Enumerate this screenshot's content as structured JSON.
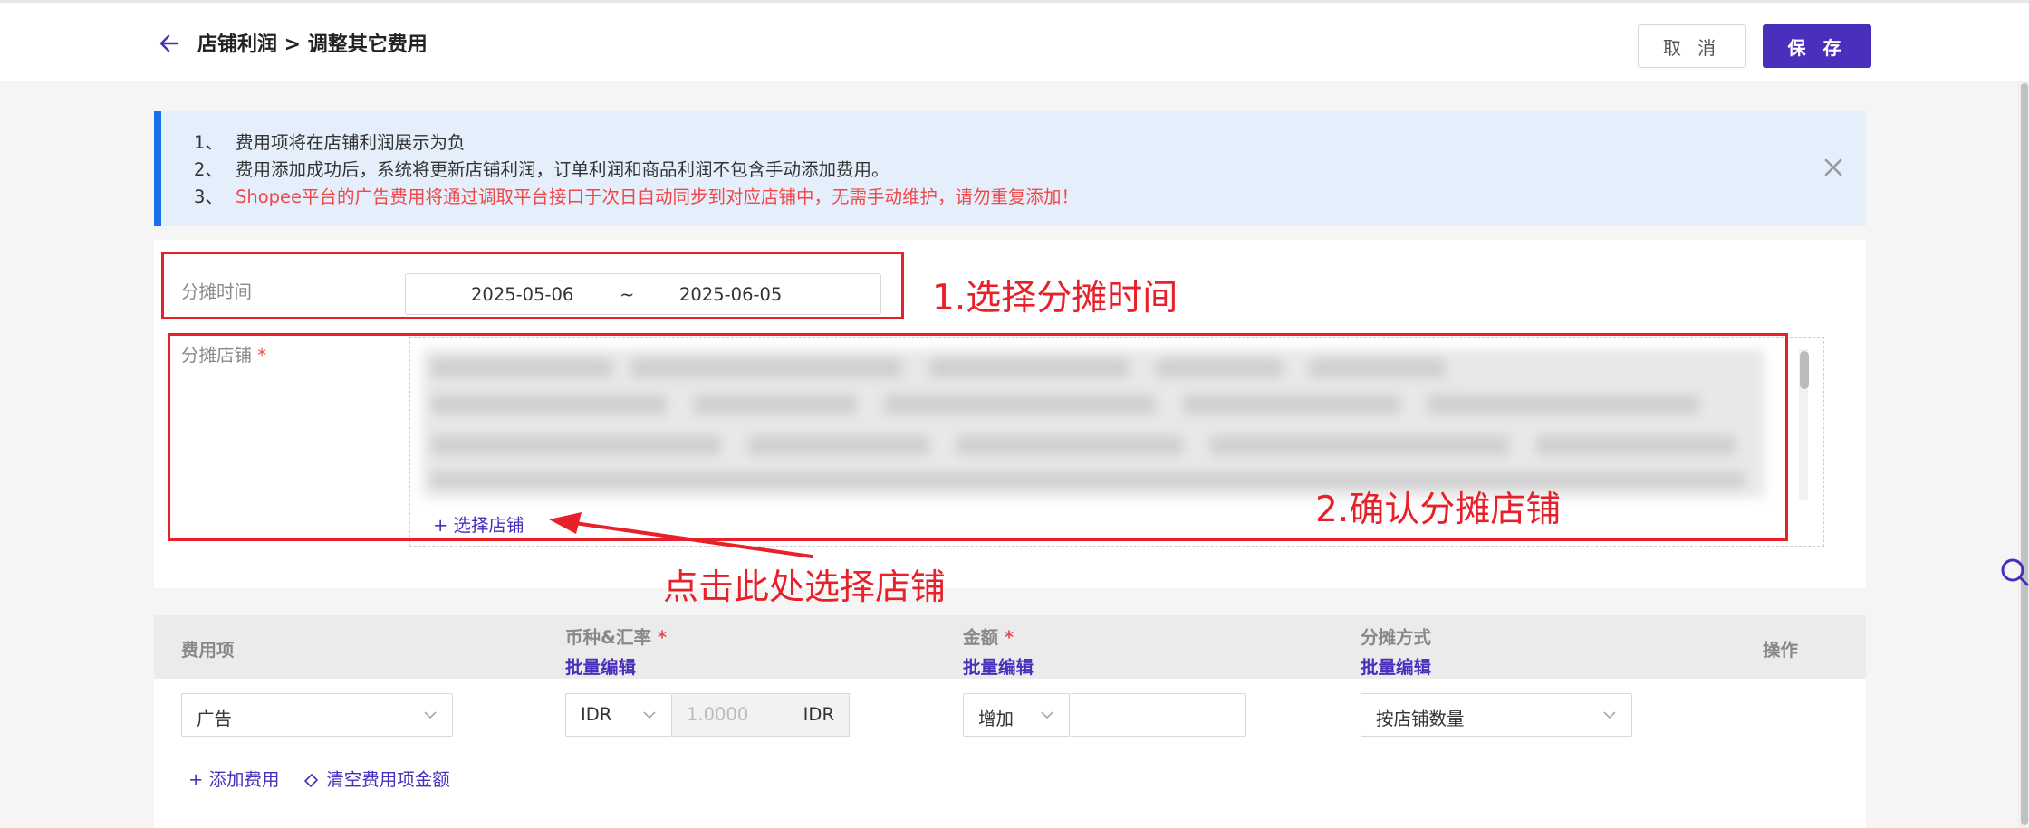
{
  "header": {
    "breadcrumb": "店铺利润 > 调整其它费用",
    "cancel_label": "取 消",
    "save_label": "保 存"
  },
  "notice": {
    "lines": [
      {
        "num": "1、",
        "text": "费用项将在店铺利润展示为负"
      },
      {
        "num": "2、",
        "text": "费用添加成功后，系统将更新店铺利润，订单利润和商品利润不包含手动添加费用。"
      },
      {
        "num": "3、",
        "text": "Shopee平台的广告费用将通过调取平台接口于次日自动同步到对应店铺中，无需手动维护，请勿重复添加！"
      }
    ]
  },
  "form": {
    "period_label": "分摊时间",
    "start_date": "2025-05-06",
    "separator": "~",
    "end_date": "2025-06-05",
    "shop_label": "分摊店铺",
    "required_mark": "*",
    "select_shop_label": "+ 选择店铺"
  },
  "annotations": {
    "step1": "1.选择分摊时间",
    "step2": "2.确认分摊店铺",
    "hint": "点击此处选择店铺"
  },
  "table": {
    "columns": [
      {
        "label": "费用项",
        "required": false,
        "sub": ""
      },
      {
        "label": "币种&汇率",
        "required": true,
        "sub": "批量编辑"
      },
      {
        "label": "金额",
        "required": true,
        "sub": "批量编辑"
      },
      {
        "label": "分摊方式",
        "required": false,
        "sub": "批量编辑"
      },
      {
        "label": "操作",
        "required": false,
        "sub": ""
      }
    ],
    "row": {
      "fee_item": "广告",
      "currency": "IDR",
      "rate_placeholder": "1.0000",
      "rate_unit": "IDR",
      "amount_type": "增加",
      "amount_value": "",
      "allocation": "按店铺数量"
    },
    "add_fee_label": "+ 添加费用",
    "clear_amount_label": "清空费用项金额"
  },
  "colors": {
    "primary": "#4a2fbd",
    "annotation_red": "#e8202a",
    "notice_bg": "#e5effc",
    "notice_border": "#1a6ee6",
    "warning_text": "#f04848"
  },
  "icons": [
    "arrow-left-icon",
    "close-icon",
    "chevron-down-icon",
    "search-icon",
    "eraser-icon"
  ]
}
